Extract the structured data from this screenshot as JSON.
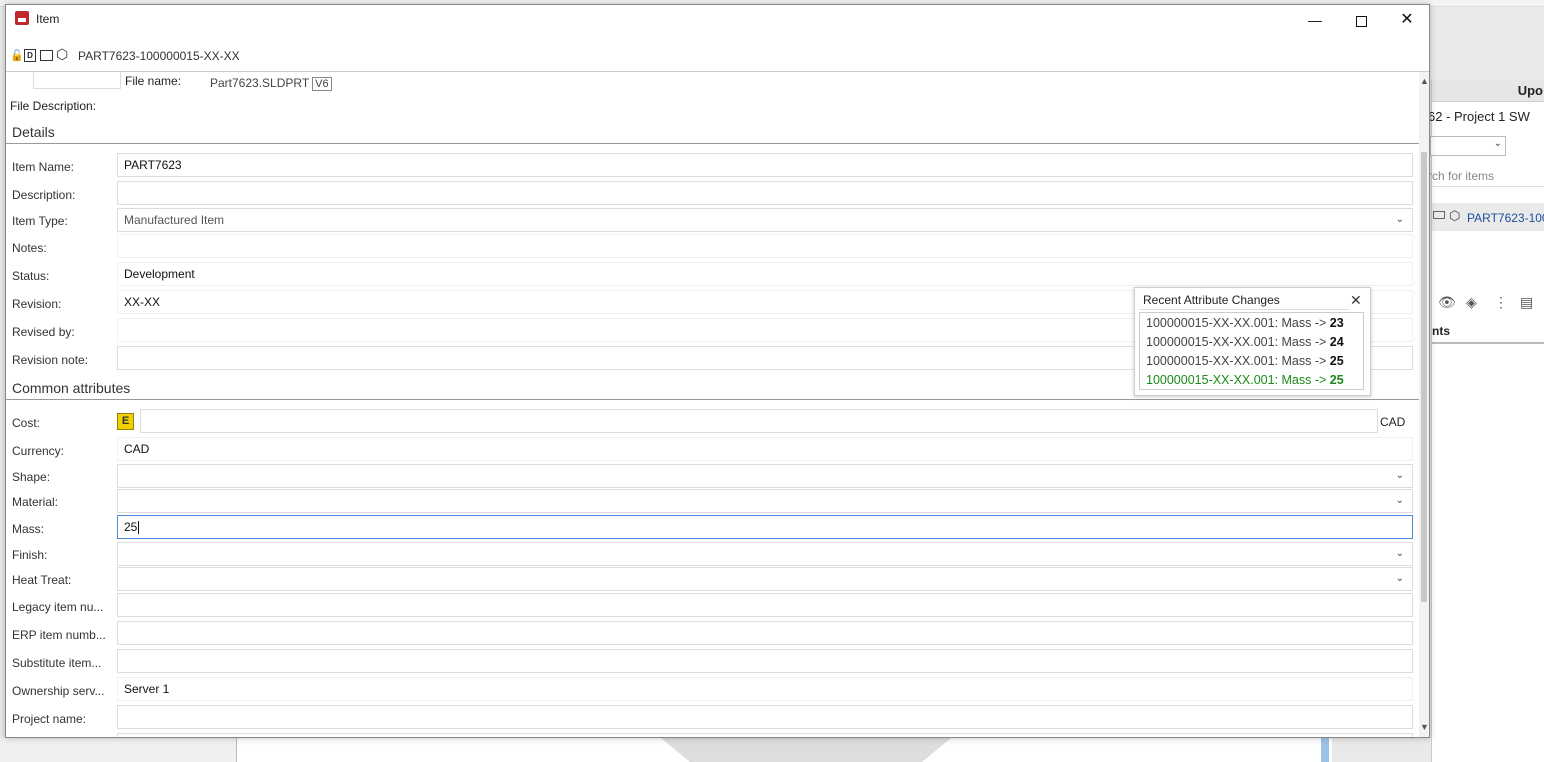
{
  "window": {
    "title": "Item",
    "minimize": "—",
    "close": "✕",
    "item_id": "PART7623-100000015-XX-XX"
  },
  "file": {
    "name_label": "File name:",
    "name_value": "Part7623.SLDPRT",
    "version": "V6",
    "description_label": "File Description:"
  },
  "details": {
    "section": "Details",
    "item_name_label": "Item Name:",
    "item_name": "PART7623",
    "description_label": "Description:",
    "description": "",
    "item_type_label": "Item Type:",
    "item_type": "Manufactured Item",
    "notes_label": "Notes:",
    "notes": "",
    "status_label": "Status:",
    "status": "Development",
    "revision_label": "Revision:",
    "revision": "XX-XX",
    "revised_by_label": "Revised by:",
    "revised_by": "",
    "revision_note_label": "Revision note:",
    "revision_note": ""
  },
  "common": {
    "section": "Common attributes",
    "cost_label": "Cost:",
    "cost_icon": "E",
    "cost": "",
    "cost_currency": "CAD",
    "currency_label": "Currency:",
    "currency": "CAD",
    "shape_label": "Shape:",
    "material_label": "Material:",
    "mass_label": "Mass:",
    "mass": "25",
    "finish_label": "Finish:",
    "heat_treat_label": "Heat Treat:",
    "legacy_label": "Legacy item nu...",
    "erp_label": "ERP item numb...",
    "substitute_label": "Substitute item...",
    "ownership_label": "Ownership serv...",
    "ownership": "Server 1",
    "project_label": "Project name:"
  },
  "popup": {
    "title": "Recent Attribute Changes",
    "close": "✕",
    "items": [
      {
        "prefix": "100000015-XX-XX.001: Mass -> ",
        "value": "23"
      },
      {
        "prefix": "100000015-XX-XX.001: Mass -> ",
        "value": "24"
      },
      {
        "prefix": "100000015-XX-XX.001: Mass -> ",
        "value": "25"
      },
      {
        "prefix": "100000015-XX-XX.001: Mass -> ",
        "value": "25"
      }
    ]
  },
  "right_panel": {
    "header": "Upo",
    "project": "62 - Project 1 SW",
    "search_placeholder": "rch for items",
    "item": "PART7623-100",
    "tab": "nts"
  },
  "colors": {
    "highlight_green": "#1a8a1a",
    "focus_blue": "#4a8ad8",
    "cost_icon": "#f0d000"
  }
}
